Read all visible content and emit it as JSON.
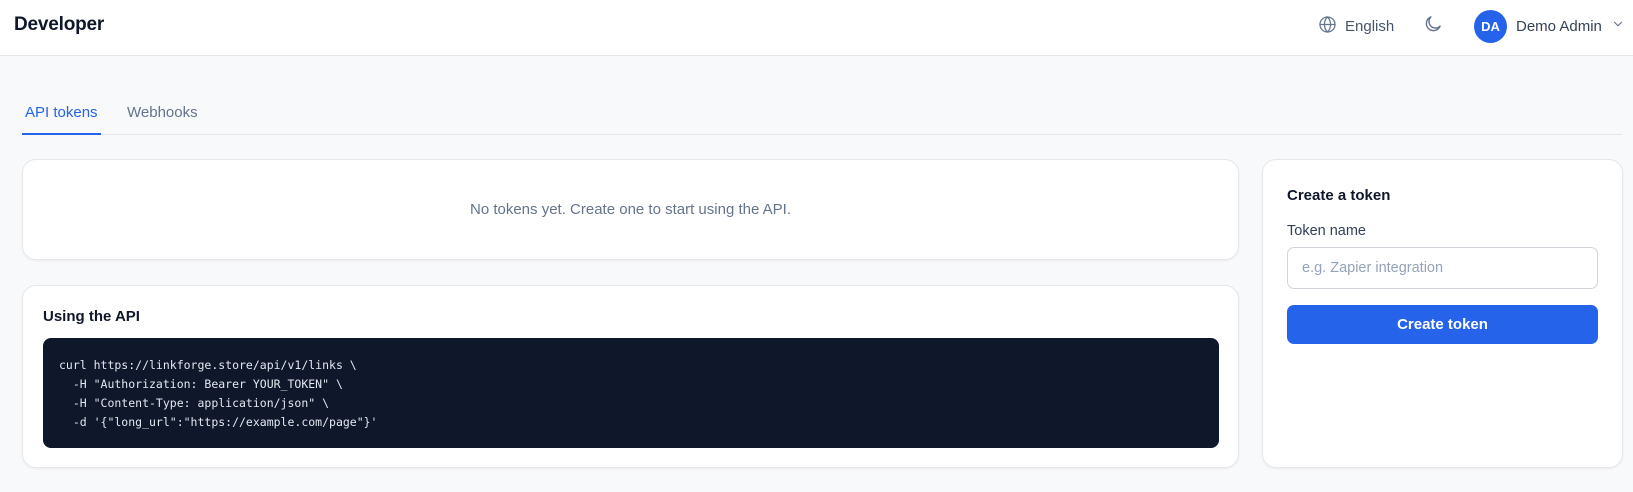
{
  "header": {
    "title": "Developer",
    "language": {
      "icon": "globe-icon",
      "label": "English"
    },
    "theme_toggle": {
      "icon": "moon-icon"
    },
    "user": {
      "initials": "DA",
      "name": "Demo Admin",
      "icon": "chevron-down-icon"
    }
  },
  "tabs": [
    {
      "label": "API tokens",
      "active": true
    },
    {
      "label": "Webhooks",
      "active": false
    }
  ],
  "tokens": {
    "empty_message": "No tokens yet. Create one to start using the API."
  },
  "usage": {
    "title": "Using the API",
    "code": "curl https://linkforge.store/api/v1/links \\\n  -H \"Authorization: Bearer YOUR_TOKEN\" \\\n  -H \"Content-Type: application/json\" \\\n  -d '{\"long_url\":\"https://example.com/page\"}'"
  },
  "create_token": {
    "title": "Create a token",
    "name_label": "Token name",
    "name_value": "",
    "name_placeholder": "e.g. Zapier integration",
    "submit_label": "Create token"
  },
  "colors": {
    "accent": "#2563eb",
    "code_background": "#0f172a",
    "page_background": "#f8f9fb"
  }
}
